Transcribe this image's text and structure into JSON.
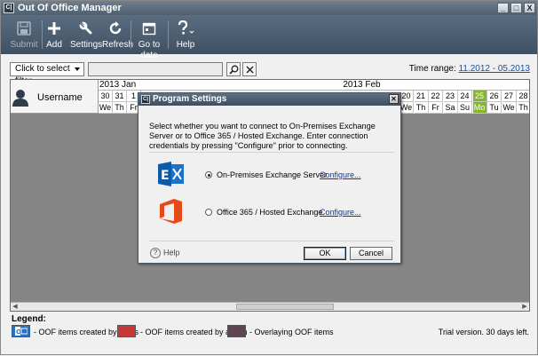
{
  "window": {
    "title": "Out Of Office Manager",
    "app_icon_text": "C|",
    "controls": [
      "_",
      "□",
      "X"
    ]
  },
  "toolbar": {
    "buttons": [
      {
        "label": "Submit",
        "icon": "floppy-icon",
        "enabled": false
      },
      {
        "label": "Add",
        "icon": "plus-icon",
        "enabled": true
      },
      {
        "label": "Settings",
        "icon": "wrench-icon",
        "enabled": true
      },
      {
        "label": "Refresh",
        "icon": "refresh-icon",
        "enabled": true
      },
      {
        "label": "Go to date",
        "icon": "calendar-icon",
        "enabled": true
      },
      {
        "label": "Help",
        "icon": "question-icon",
        "enabled": true
      }
    ]
  },
  "filter": {
    "select_label": "Click to select filter",
    "search_value": "",
    "time_range_label": "Time range:",
    "time_range_value": "11.2012 - 05.2013"
  },
  "grid": {
    "user_header": "Username",
    "months": [
      {
        "label": "2013 Jan"
      },
      {
        "label": "2013 Feb"
      }
    ],
    "left_days": [
      {
        "day": "30",
        "wd": "We"
      },
      {
        "day": "31",
        "wd": "Th"
      },
      {
        "day": "1",
        "wd": "Fr"
      }
    ],
    "right_days": [
      {
        "day": "20",
        "wd": "We",
        "highlight": false
      },
      {
        "day": "21",
        "wd": "Th",
        "highlight": false
      },
      {
        "day": "22",
        "wd": "Fr",
        "highlight": false
      },
      {
        "day": "23",
        "wd": "Sa",
        "highlight": false
      },
      {
        "day": "24",
        "wd": "Su",
        "highlight": false
      },
      {
        "day": "25",
        "wd": "Mo",
        "highlight": true
      },
      {
        "day": "26",
        "wd": "Tu",
        "highlight": false
      },
      {
        "day": "27",
        "wd": "We",
        "highlight": false
      },
      {
        "day": "28",
        "wd": "Th",
        "highlight": false
      }
    ]
  },
  "dialog": {
    "title": "Program Settings",
    "icon_text": "C|",
    "description": "Select whether you want to connect to On-Premises Exchange Server or to Office 365 / Hosted Exchange. Enter connection credentials by pressing \"Configure\" prior to connecting.",
    "options": [
      {
        "label": "On-Premises Exchange Server",
        "selected": true,
        "configure": "Configure...",
        "logo": "exchange-logo"
      },
      {
        "label": "Office 365 / Hosted Exchange",
        "selected": false,
        "configure": "Configure...",
        "logo": "office-logo"
      }
    ],
    "help_label": "Help",
    "ok_label": "OK",
    "cancel_label": "Cancel"
  },
  "legend": {
    "title": "Legend:",
    "items": [
      {
        "label": "- OOF items created by users",
        "color": "#1e74c8"
      },
      {
        "label": "- OOF items created by admin",
        "color": "#c83737"
      },
      {
        "label": "- Overlaying OOF items",
        "color": "#5e4553"
      }
    ],
    "trial_text": "Trial version. 30 days left."
  },
  "colors": {
    "toolbar": "#4b5d6f",
    "highlight_day": "#86b52e",
    "grid_body": "#868686"
  }
}
